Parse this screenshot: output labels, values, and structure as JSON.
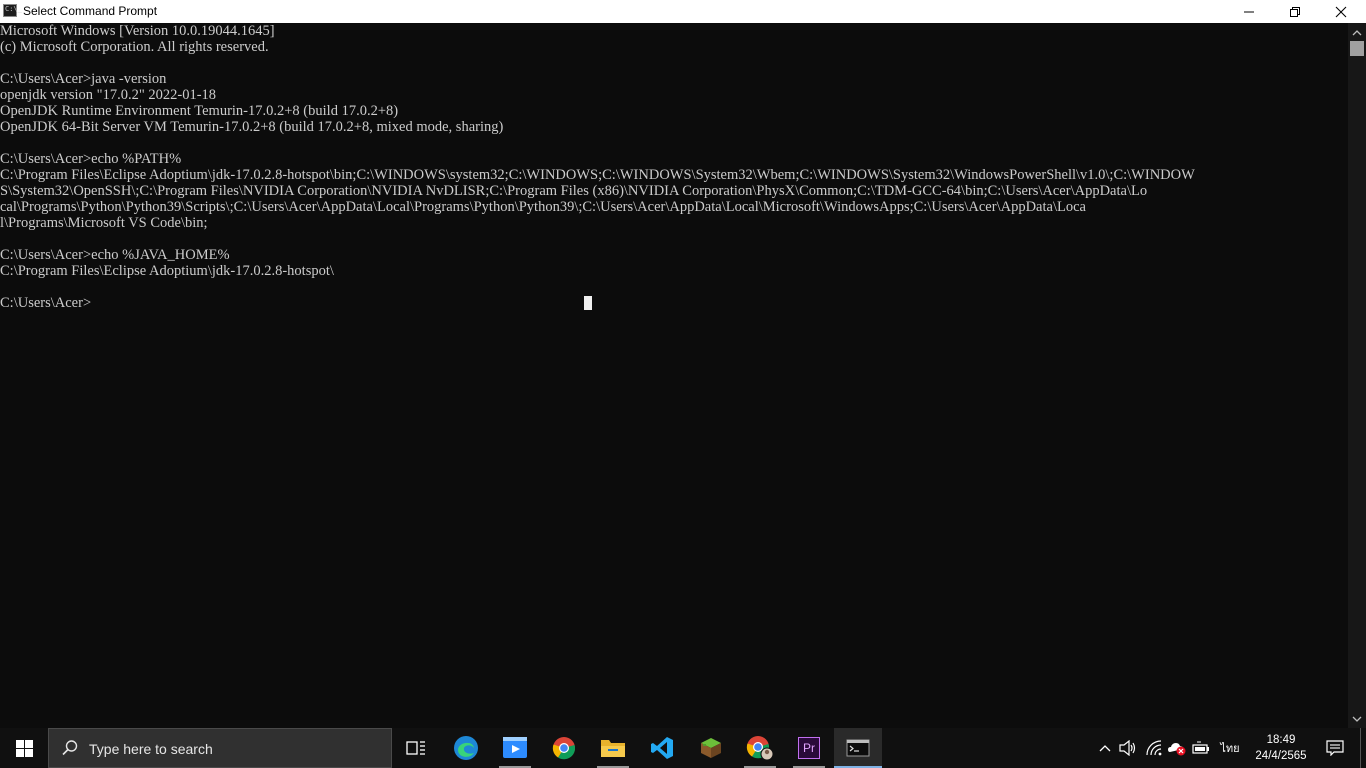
{
  "window": {
    "title": "Select Command Prompt",
    "icon": "cmd-icon",
    "icon_text": "C:\\_"
  },
  "console": {
    "lines": [
      "Microsoft Windows [Version 10.0.19044.1645]",
      "(c) Microsoft Corporation. All rights reserved.",
      "",
      "C:\\Users\\Acer>java -version",
      "openjdk version \"17.0.2\" 2022-01-18",
      "OpenJDK Runtime Environment Temurin-17.0.2+8 (build 17.0.2+8)",
      "OpenJDK 64-Bit Server VM Temurin-17.0.2+8 (build 17.0.2+8, mixed mode, sharing)",
      "",
      "C:\\Users\\Acer>echo %PATH%",
      "C:\\Program Files\\Eclipse Adoptium\\jdk-17.0.2.8-hotspot\\bin;C:\\WINDOWS\\system32;C:\\WINDOWS;C:\\WINDOWS\\System32\\Wbem;C:\\WINDOWS\\System32\\WindowsPowerShell\\v1.0\\;C:\\WINDOW",
      "S\\System32\\OpenSSH\\;C:\\Program Files\\NVIDIA Corporation\\NVIDIA NvDLISR;C:\\Program Files (x86)\\NVIDIA Corporation\\PhysX\\Common;C:\\TDM-GCC-64\\bin;C:\\Users\\Acer\\AppData\\Lo",
      "cal\\Programs\\Python\\Python39\\Scripts\\;C:\\Users\\Acer\\AppData\\Local\\Programs\\Python\\Python39\\;C:\\Users\\Acer\\AppData\\Local\\Microsoft\\WindowsApps;C:\\Users\\Acer\\AppData\\Loca",
      "l\\Programs\\Microsoft VS Code\\bin;",
      "",
      "C:\\Users\\Acer>echo %JAVA_HOME%",
      "C:\\Program Files\\Eclipse Adoptium\\jdk-17.0.2.8-hotspot\\",
      "",
      "C:\\Users\\Acer>"
    ],
    "colors": {
      "background": "#0c0c0c",
      "text": "#cccccc"
    }
  },
  "taskbar": {
    "search_placeholder": "Type here to search",
    "pinned": [
      {
        "name": "task-view-icon"
      },
      {
        "name": "edge-icon"
      },
      {
        "name": "zoom-icon"
      },
      {
        "name": "chrome-icon"
      },
      {
        "name": "file-explorer-icon"
      },
      {
        "name": "vscode-icon"
      },
      {
        "name": "minecraft-icon"
      },
      {
        "name": "chrome-profile-icon"
      },
      {
        "name": "premiere-pro-icon",
        "text": "Pr"
      },
      {
        "name": "command-prompt-icon",
        "active": true
      }
    ],
    "tray": {
      "language": "ไทย",
      "time": "18:49",
      "date": "24/4/2565"
    }
  }
}
